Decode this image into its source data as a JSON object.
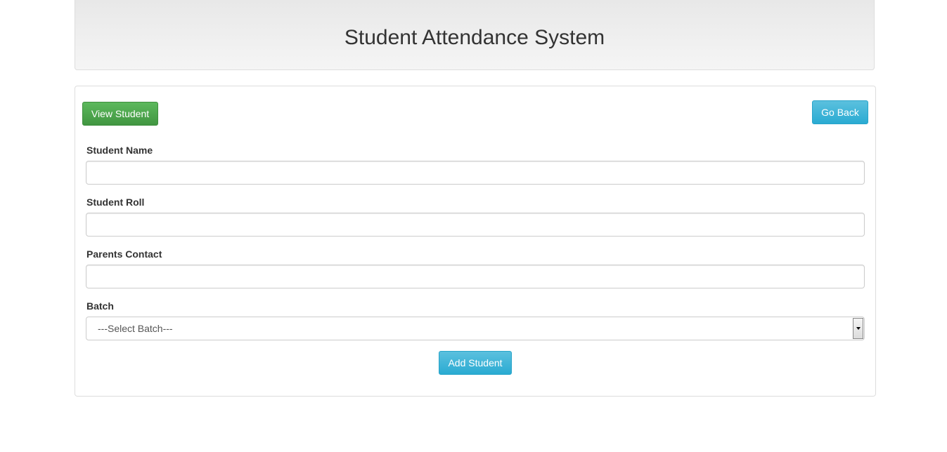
{
  "header": {
    "title": "Student Attendance System"
  },
  "toolbar": {
    "view_student_label": "View Student",
    "go_back_label": "Go Back"
  },
  "form": {
    "student_name": {
      "label": "Student Name",
      "value": ""
    },
    "student_roll": {
      "label": "Student Roll",
      "value": ""
    },
    "parents_contact": {
      "label": "Parents Contact",
      "value": ""
    },
    "batch": {
      "label": "Batch",
      "selected": "---Select Batch---"
    },
    "submit_label": "Add Student"
  },
  "colors": {
    "success": "#5cb85c",
    "info": "#5bc0de"
  }
}
